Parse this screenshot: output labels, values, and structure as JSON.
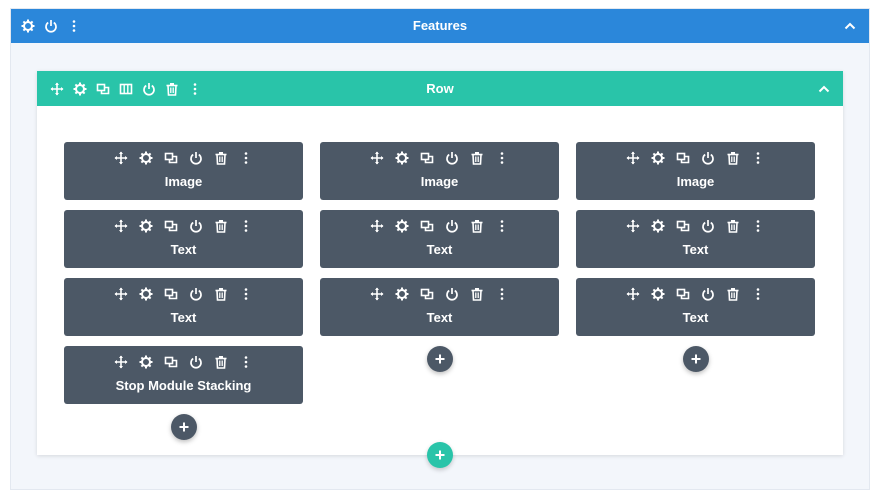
{
  "colors": {
    "section_header": "#2b87da",
    "row_header": "#29c4a9",
    "module_bg": "#4c5866",
    "canvas_bg": "#f3f6fb"
  },
  "section": {
    "title": "Features",
    "icons": [
      "gear-icon",
      "power-icon",
      "more-vertical-icon"
    ],
    "chevron": "chevron-up-icon"
  },
  "row": {
    "title": "Row",
    "icons": [
      "move-icon",
      "gear-icon",
      "duplicate-icon",
      "columns-icon",
      "power-icon",
      "trash-icon",
      "more-vertical-icon"
    ],
    "chevron": "chevron-up-icon",
    "add_row_icon": "plus-icon"
  },
  "module_icons": [
    "move-icon",
    "gear-icon",
    "duplicate-icon",
    "power-icon",
    "trash-icon",
    "more-vertical-icon"
  ],
  "columns": [
    {
      "modules": [
        {
          "label": "Image"
        },
        {
          "label": "Text"
        },
        {
          "label": "Text"
        },
        {
          "label": "Stop Module Stacking"
        }
      ]
    },
    {
      "modules": [
        {
          "label": "Image"
        },
        {
          "label": "Text"
        },
        {
          "label": "Text"
        }
      ]
    },
    {
      "modules": [
        {
          "label": "Image"
        },
        {
          "label": "Text"
        },
        {
          "label": "Text"
        }
      ]
    }
  ]
}
